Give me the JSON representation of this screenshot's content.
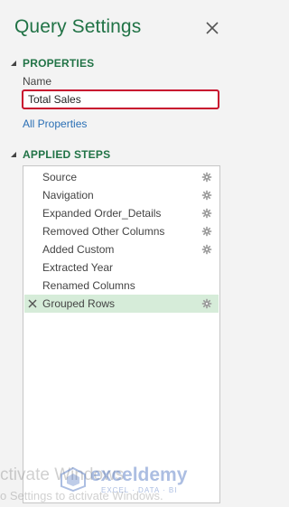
{
  "pane": {
    "title": "Query Settings"
  },
  "properties": {
    "heading": "PROPERTIES",
    "name_label": "Name",
    "name_value": "Total Sales",
    "all_properties_link": "All Properties"
  },
  "applied_steps": {
    "heading": "APPLIED STEPS",
    "steps": [
      {
        "label": "Source",
        "gear": true,
        "selected": false
      },
      {
        "label": "Navigation",
        "gear": true,
        "selected": false
      },
      {
        "label": "Expanded Order_Details",
        "gear": true,
        "selected": false
      },
      {
        "label": "Removed Other Columns",
        "gear": true,
        "selected": false
      },
      {
        "label": "Added Custom",
        "gear": true,
        "selected": false
      },
      {
        "label": "Extracted Year",
        "gear": false,
        "selected": false
      },
      {
        "label": "Renamed Columns",
        "gear": false,
        "selected": false
      },
      {
        "label": "Grouped Rows",
        "gear": true,
        "selected": true
      }
    ]
  },
  "overlay": {
    "activate_line1": "ctivate Windows",
    "activate_line2": "o Settings to activate Windows.",
    "brand": "exceldemy",
    "brand_tagline": "EXCEL · DATA · BI"
  },
  "colors": {
    "accent_green": "#217346",
    "selected_row": "#d6ecd9",
    "input_border": "#c8102e",
    "link_blue": "#2a6fb5"
  }
}
